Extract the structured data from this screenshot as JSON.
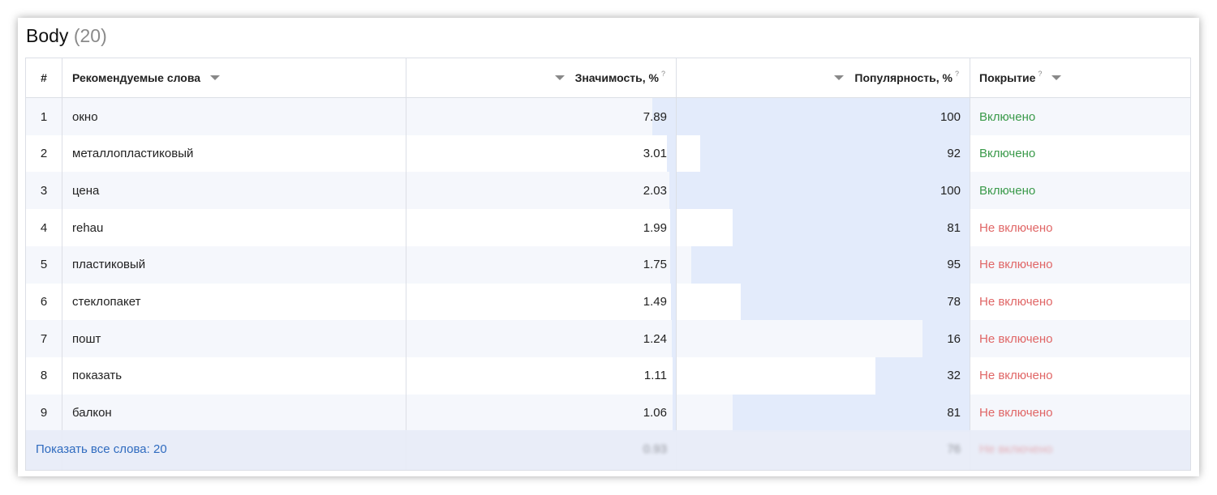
{
  "section": {
    "title": "Body",
    "count": "(20)"
  },
  "columns": {
    "index": "#",
    "word": "Рекомендуемые слова",
    "significance": "Значимость, %",
    "popularity": "Популярность, %",
    "coverage": "Покрытие",
    "help_mark": "?"
  },
  "rows": [
    {
      "n": "1",
      "word": "окно",
      "significance": "7.89",
      "popularity": "100",
      "coverage": "Включено"
    },
    {
      "n": "2",
      "word": "металлопластиковый",
      "significance": "3.01",
      "popularity": "92",
      "coverage": "Включено"
    },
    {
      "n": "3",
      "word": "цена",
      "significance": "2.03",
      "popularity": "100",
      "coverage": "Включено"
    },
    {
      "n": "4",
      "word": "rehau",
      "significance": "1.99",
      "popularity": "81",
      "coverage": "Не включено"
    },
    {
      "n": "5",
      "word": "пластиковый",
      "significance": "1.75",
      "popularity": "95",
      "coverage": "Не включено"
    },
    {
      "n": "6",
      "word": "стеклопакет",
      "significance": "1.49",
      "popularity": "78",
      "coverage": "Не включено"
    },
    {
      "n": "7",
      "word": "пошт",
      "significance": "1.24",
      "popularity": "16",
      "coverage": "Не включено"
    },
    {
      "n": "8",
      "word": "показать",
      "significance": "1.11",
      "popularity": "32",
      "coverage": "Не включено"
    },
    {
      "n": "9",
      "word": "балкон",
      "significance": "1.06",
      "popularity": "81",
      "coverage": "Не включено"
    }
  ],
  "footer": {
    "show_all": "Показать все слова: 20",
    "ghost_significance": "0.93",
    "ghost_popularity": "76",
    "ghost_coverage": "Не включено"
  },
  "colors": {
    "bar": "#e3ebfb",
    "included": "#3a9a4a",
    "not_included": "#e06666",
    "link": "#2f6bbf"
  }
}
